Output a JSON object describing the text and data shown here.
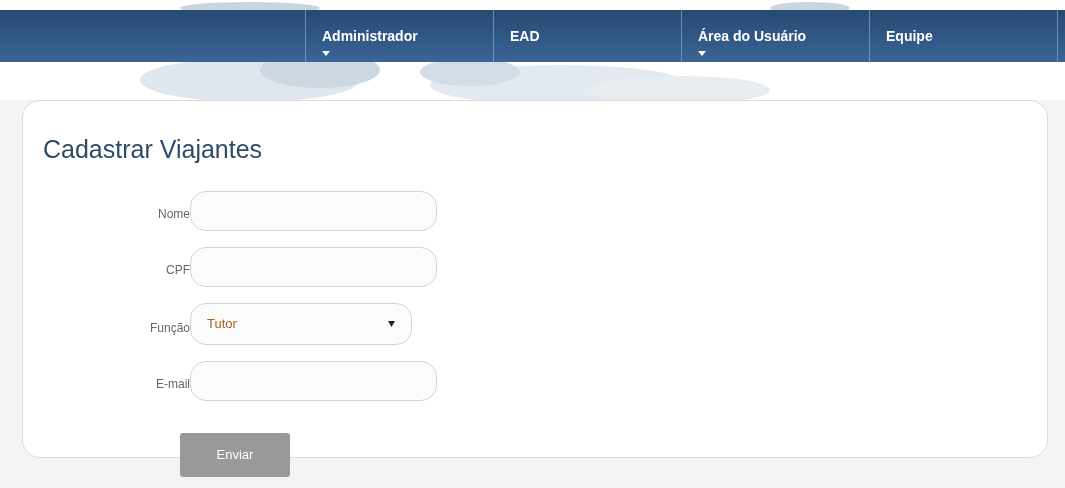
{
  "nav": {
    "items": [
      {
        "label": "Administrador",
        "has_menu": true
      },
      {
        "label": "EAD",
        "has_menu": false
      },
      {
        "label": "Área do Usuário",
        "has_menu": true
      },
      {
        "label": "Equipe",
        "has_menu": false
      }
    ]
  },
  "form": {
    "title": "Cadastrar Viajantes",
    "fields": [
      {
        "kind": "text",
        "label": "Nome"
      },
      {
        "kind": "text",
        "label": "CPF"
      },
      {
        "kind": "select",
        "label": "Função",
        "value": "Tutor"
      },
      {
        "kind": "text",
        "label": "E-mail"
      }
    ],
    "submit": "Enviar"
  }
}
